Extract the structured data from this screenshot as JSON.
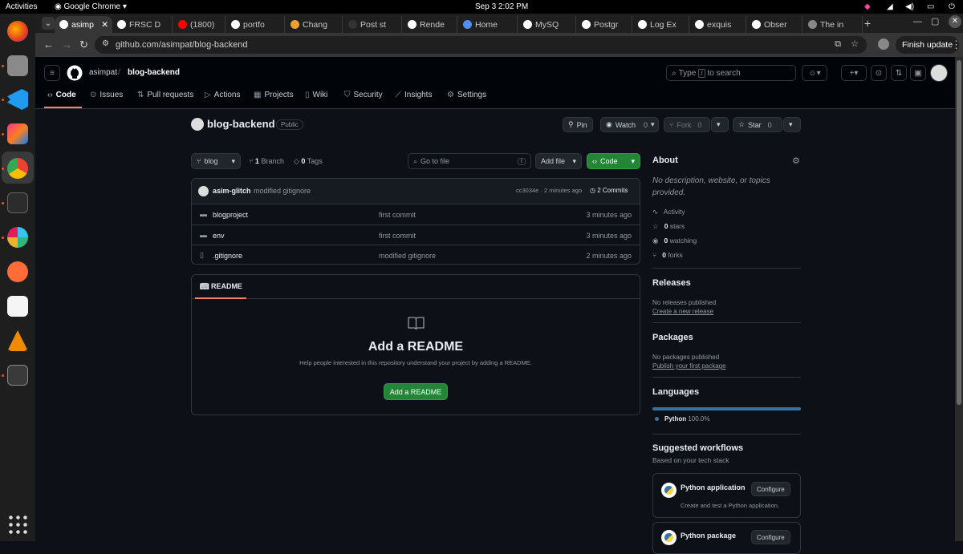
{
  "topbar": {
    "activities": "Activities",
    "app": "Google Chrome",
    "clock": "Sep 3  2:02 PM"
  },
  "tabs": [
    {
      "label": "asimp",
      "color": "#ffffff"
    },
    {
      "label": "FRSC D",
      "color": "#ffffff"
    },
    {
      "label": "(1800)",
      "color": "#ff0000"
    },
    {
      "label": "portfo",
      "color": "#ffffff"
    },
    {
      "label": "Chang",
      "color": "#f0a030"
    },
    {
      "label": "Post st",
      "color": "#333333"
    },
    {
      "label": "Rende",
      "color": "#ffffff"
    },
    {
      "label": "Home",
      "color": "#4f8ef7"
    },
    {
      "label": "MySQ",
      "color": "#ffffff"
    },
    {
      "label": "Postgr",
      "color": "#ffffff"
    },
    {
      "label": "Log Ex",
      "color": "#ffffff"
    },
    {
      "label": "exquis",
      "color": "#ffffff"
    },
    {
      "label": "Obser",
      "color": "#ffffff"
    },
    {
      "label": "The in",
      "color": "#888888"
    }
  ],
  "browser": {
    "url": "github.com/asimpat/blog-backend",
    "finish_update": "Finish update"
  },
  "gh": {
    "owner": "asimpat",
    "slash": "/",
    "repo": "blog-backend",
    "search_pre": "Type",
    "search_key": "/",
    "search_post": "to search",
    "nav": [
      {
        "label": "Code",
        "icon": "code"
      },
      {
        "label": "Issues",
        "icon": "issue"
      },
      {
        "label": "Pull requests",
        "icon": "pr"
      },
      {
        "label": "Actions",
        "icon": "play"
      },
      {
        "label": "Projects",
        "icon": "table"
      },
      {
        "label": "Wiki",
        "icon": "book"
      },
      {
        "label": "Security",
        "icon": "shield"
      },
      {
        "label": "Insights",
        "icon": "graph"
      },
      {
        "label": "Settings",
        "icon": "gear"
      }
    ]
  },
  "repo": {
    "name": "blog-backend",
    "visibility": "Public",
    "pin": "Pin",
    "watch": "Watch",
    "watch_count": "0",
    "fork": "Fork",
    "fork_count": "0",
    "star": "Star",
    "star_count": "0",
    "branch_btn": "blog",
    "branch_count": "1",
    "branch_label": "Branch",
    "tag_count": "0",
    "tag_label": "Tags",
    "goto_placeholder": "Go to file",
    "goto_key": "t",
    "add_file": "Add file",
    "code_btn": "Code"
  },
  "commit": {
    "author": "asim-glitch",
    "message": "modified gitignore",
    "meta": "cc3034e · 2 minutes ago",
    "commits": "2 Commits"
  },
  "files": [
    {
      "name": "blogproject",
      "type": "dir",
      "msg": "first commit",
      "time": "3 minutes ago"
    },
    {
      "name": "env",
      "type": "dir",
      "msg": "first commit",
      "time": "3 minutes ago"
    },
    {
      "name": ".gitignore",
      "type": "file",
      "msg": "modified gitignore",
      "time": "2 minutes ago"
    }
  ],
  "readme": {
    "tab": "README",
    "title": "Add a README",
    "help": "Help people interested in this repository understand your project by adding a README.",
    "button": "Add a README"
  },
  "about": {
    "title": "About",
    "desc": "No description, website, or topics provided.",
    "activity": "Activity",
    "stars_n": "0",
    "stars_l": "stars",
    "watching_n": "0",
    "watching_l": "watching",
    "forks_n": "0",
    "forks_l": "forks"
  },
  "releases": {
    "title": "Releases",
    "text": "No releases published",
    "link": "Create a new release"
  },
  "packages": {
    "title": "Packages",
    "text": "No packages published",
    "link": "Publish your first package"
  },
  "languages": {
    "title": "Languages",
    "name": "Python",
    "pct": "100.0%",
    "color": "#3572A5"
  },
  "workflows": {
    "title": "Suggested workflows",
    "subtitle": "Based on your tech stack",
    "items": [
      {
        "name": "Python application",
        "desc": "Create and test a Python application.",
        "button": "Configure"
      },
      {
        "name": "Python package",
        "button": "Configure"
      }
    ]
  }
}
